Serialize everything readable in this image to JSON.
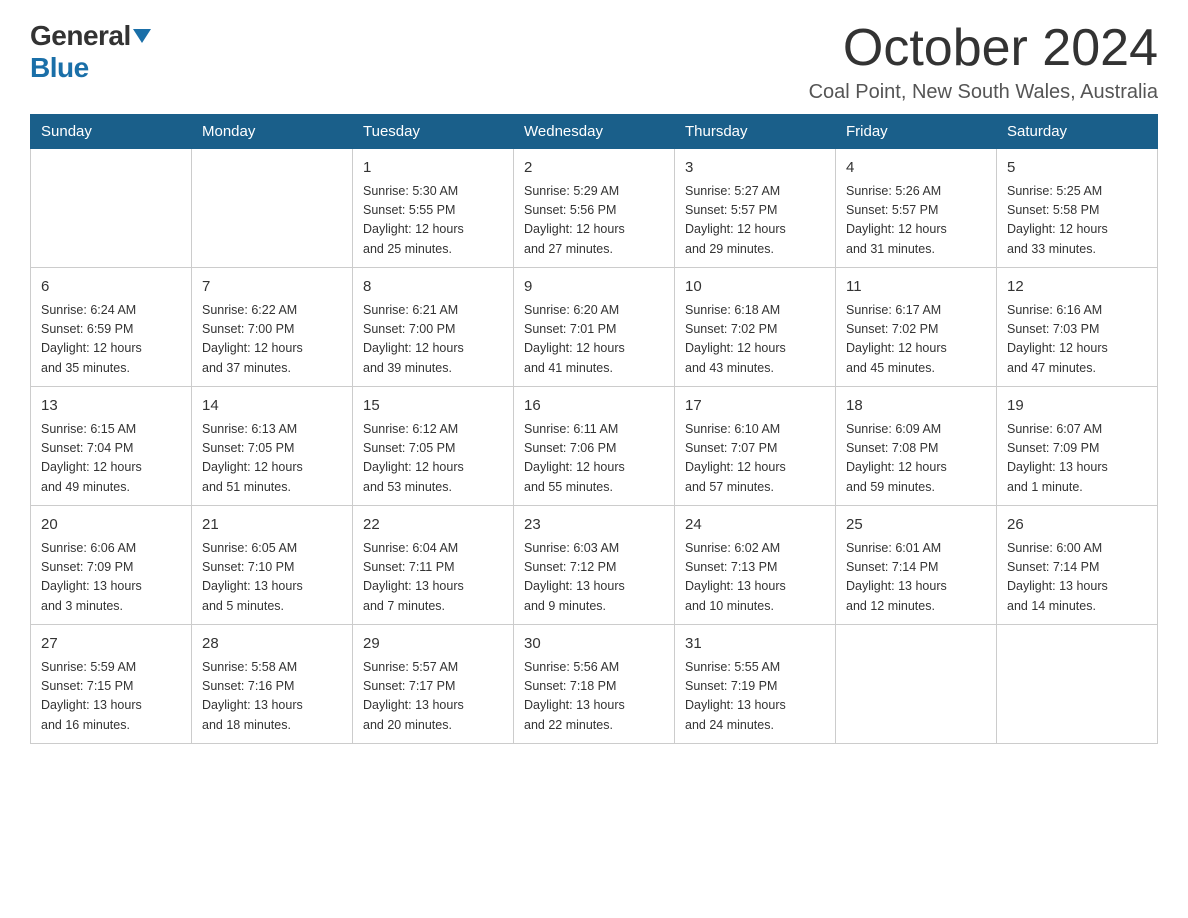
{
  "header": {
    "logo_general": "General",
    "logo_blue": "Blue",
    "month_title": "October 2024",
    "location": "Coal Point, New South Wales, Australia"
  },
  "weekdays": [
    "Sunday",
    "Monday",
    "Tuesday",
    "Wednesday",
    "Thursday",
    "Friday",
    "Saturday"
  ],
  "weeks": [
    [
      {
        "day": "",
        "info": ""
      },
      {
        "day": "",
        "info": ""
      },
      {
        "day": "1",
        "info": "Sunrise: 5:30 AM\nSunset: 5:55 PM\nDaylight: 12 hours\nand 25 minutes."
      },
      {
        "day": "2",
        "info": "Sunrise: 5:29 AM\nSunset: 5:56 PM\nDaylight: 12 hours\nand 27 minutes."
      },
      {
        "day": "3",
        "info": "Sunrise: 5:27 AM\nSunset: 5:57 PM\nDaylight: 12 hours\nand 29 minutes."
      },
      {
        "day": "4",
        "info": "Sunrise: 5:26 AM\nSunset: 5:57 PM\nDaylight: 12 hours\nand 31 minutes."
      },
      {
        "day": "5",
        "info": "Sunrise: 5:25 AM\nSunset: 5:58 PM\nDaylight: 12 hours\nand 33 minutes."
      }
    ],
    [
      {
        "day": "6",
        "info": "Sunrise: 6:24 AM\nSunset: 6:59 PM\nDaylight: 12 hours\nand 35 minutes."
      },
      {
        "day": "7",
        "info": "Sunrise: 6:22 AM\nSunset: 7:00 PM\nDaylight: 12 hours\nand 37 minutes."
      },
      {
        "day": "8",
        "info": "Sunrise: 6:21 AM\nSunset: 7:00 PM\nDaylight: 12 hours\nand 39 minutes."
      },
      {
        "day": "9",
        "info": "Sunrise: 6:20 AM\nSunset: 7:01 PM\nDaylight: 12 hours\nand 41 minutes."
      },
      {
        "day": "10",
        "info": "Sunrise: 6:18 AM\nSunset: 7:02 PM\nDaylight: 12 hours\nand 43 minutes."
      },
      {
        "day": "11",
        "info": "Sunrise: 6:17 AM\nSunset: 7:02 PM\nDaylight: 12 hours\nand 45 minutes."
      },
      {
        "day": "12",
        "info": "Sunrise: 6:16 AM\nSunset: 7:03 PM\nDaylight: 12 hours\nand 47 minutes."
      }
    ],
    [
      {
        "day": "13",
        "info": "Sunrise: 6:15 AM\nSunset: 7:04 PM\nDaylight: 12 hours\nand 49 minutes."
      },
      {
        "day": "14",
        "info": "Sunrise: 6:13 AM\nSunset: 7:05 PM\nDaylight: 12 hours\nand 51 minutes."
      },
      {
        "day": "15",
        "info": "Sunrise: 6:12 AM\nSunset: 7:05 PM\nDaylight: 12 hours\nand 53 minutes."
      },
      {
        "day": "16",
        "info": "Sunrise: 6:11 AM\nSunset: 7:06 PM\nDaylight: 12 hours\nand 55 minutes."
      },
      {
        "day": "17",
        "info": "Sunrise: 6:10 AM\nSunset: 7:07 PM\nDaylight: 12 hours\nand 57 minutes."
      },
      {
        "day": "18",
        "info": "Sunrise: 6:09 AM\nSunset: 7:08 PM\nDaylight: 12 hours\nand 59 minutes."
      },
      {
        "day": "19",
        "info": "Sunrise: 6:07 AM\nSunset: 7:09 PM\nDaylight: 13 hours\nand 1 minute."
      }
    ],
    [
      {
        "day": "20",
        "info": "Sunrise: 6:06 AM\nSunset: 7:09 PM\nDaylight: 13 hours\nand 3 minutes."
      },
      {
        "day": "21",
        "info": "Sunrise: 6:05 AM\nSunset: 7:10 PM\nDaylight: 13 hours\nand 5 minutes."
      },
      {
        "day": "22",
        "info": "Sunrise: 6:04 AM\nSunset: 7:11 PM\nDaylight: 13 hours\nand 7 minutes."
      },
      {
        "day": "23",
        "info": "Sunrise: 6:03 AM\nSunset: 7:12 PM\nDaylight: 13 hours\nand 9 minutes."
      },
      {
        "day": "24",
        "info": "Sunrise: 6:02 AM\nSunset: 7:13 PM\nDaylight: 13 hours\nand 10 minutes."
      },
      {
        "day": "25",
        "info": "Sunrise: 6:01 AM\nSunset: 7:14 PM\nDaylight: 13 hours\nand 12 minutes."
      },
      {
        "day": "26",
        "info": "Sunrise: 6:00 AM\nSunset: 7:14 PM\nDaylight: 13 hours\nand 14 minutes."
      }
    ],
    [
      {
        "day": "27",
        "info": "Sunrise: 5:59 AM\nSunset: 7:15 PM\nDaylight: 13 hours\nand 16 minutes."
      },
      {
        "day": "28",
        "info": "Sunrise: 5:58 AM\nSunset: 7:16 PM\nDaylight: 13 hours\nand 18 minutes."
      },
      {
        "day": "29",
        "info": "Sunrise: 5:57 AM\nSunset: 7:17 PM\nDaylight: 13 hours\nand 20 minutes."
      },
      {
        "day": "30",
        "info": "Sunrise: 5:56 AM\nSunset: 7:18 PM\nDaylight: 13 hours\nand 22 minutes."
      },
      {
        "day": "31",
        "info": "Sunrise: 5:55 AM\nSunset: 7:19 PM\nDaylight: 13 hours\nand 24 minutes."
      },
      {
        "day": "",
        "info": ""
      },
      {
        "day": "",
        "info": ""
      }
    ]
  ]
}
